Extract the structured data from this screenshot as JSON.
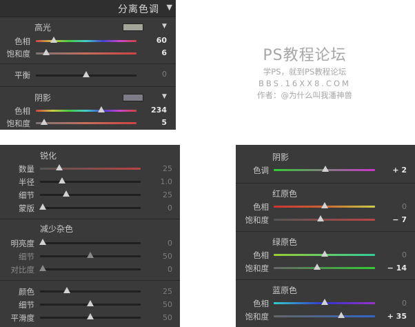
{
  "split_toning": {
    "title": "分离色调",
    "highlights": {
      "label": "高光",
      "swatch_color": "#a3a598",
      "hue": {
        "label": "色相",
        "value": "60",
        "pos": 0.18
      },
      "saturation": {
        "label": "饱和度",
        "value": "6",
        "pos": 0.1
      }
    },
    "balance": {
      "label": "平衡",
      "value": "0",
      "pos": 0.5
    },
    "shadows": {
      "label": "阴影",
      "swatch_color": "#7d7c86",
      "hue": {
        "label": "色相",
        "value": "234",
        "pos": 0.65
      },
      "saturation": {
        "label": "饱和度",
        "value": "5",
        "pos": 0.08
      }
    }
  },
  "watermark": {
    "line1": "PS教程论坛",
    "line2": "学PS，就到PS教程论坛",
    "line3": "BBS.16XX8.COM",
    "line4": "作者：@为什么叫我潘神兽"
  },
  "detail": {
    "sharpening": {
      "title": "锐化",
      "rows": [
        {
          "label": "数量",
          "value": "25",
          "pos": 0.19
        },
        {
          "label": "半径",
          "value": "1.0",
          "pos": 0.22
        },
        {
          "label": "细节",
          "value": "25",
          "pos": 0.26
        },
        {
          "label": "蒙版",
          "value": "0",
          "pos": 0.03
        }
      ]
    },
    "noise": {
      "title": "减少杂色",
      "rows": [
        {
          "label": "明亮度",
          "value": "0",
          "pos": 0.03
        },
        {
          "label": "细节",
          "value": "50",
          "pos": 0.5
        },
        {
          "label": "对比度",
          "value": "0",
          "pos": 0.03
        }
      ],
      "color_rows": [
        {
          "label": "颜色",
          "value": "25",
          "pos": 0.27
        },
        {
          "label": "细节",
          "value": "50",
          "pos": 0.5
        },
        {
          "label": "平滑度",
          "value": "50",
          "pos": 0.5
        }
      ]
    }
  },
  "calibration": {
    "shadows": {
      "title": "阴影",
      "tint": {
        "label": "色调",
        "value": "+ 2",
        "pos": 0.51
      }
    },
    "red_primary": {
      "title": "红原色",
      "hue": {
        "label": "色相",
        "value": "0",
        "pos": 0.5
      },
      "saturation": {
        "label": "饱和度",
        "value": "− 7",
        "pos": 0.46
      }
    },
    "green_primary": {
      "title": "绿原色",
      "hue": {
        "label": "色相",
        "value": "0",
        "pos": 0.5
      },
      "saturation": {
        "label": "饱和度",
        "value": "− 14",
        "pos": 0.43
      }
    },
    "blue_primary": {
      "title": "蓝原色",
      "hue": {
        "label": "色相",
        "value": "0",
        "pos": 0.5
      },
      "saturation": {
        "label": "饱和度",
        "value": "+ 35",
        "pos": 0.67
      }
    }
  }
}
